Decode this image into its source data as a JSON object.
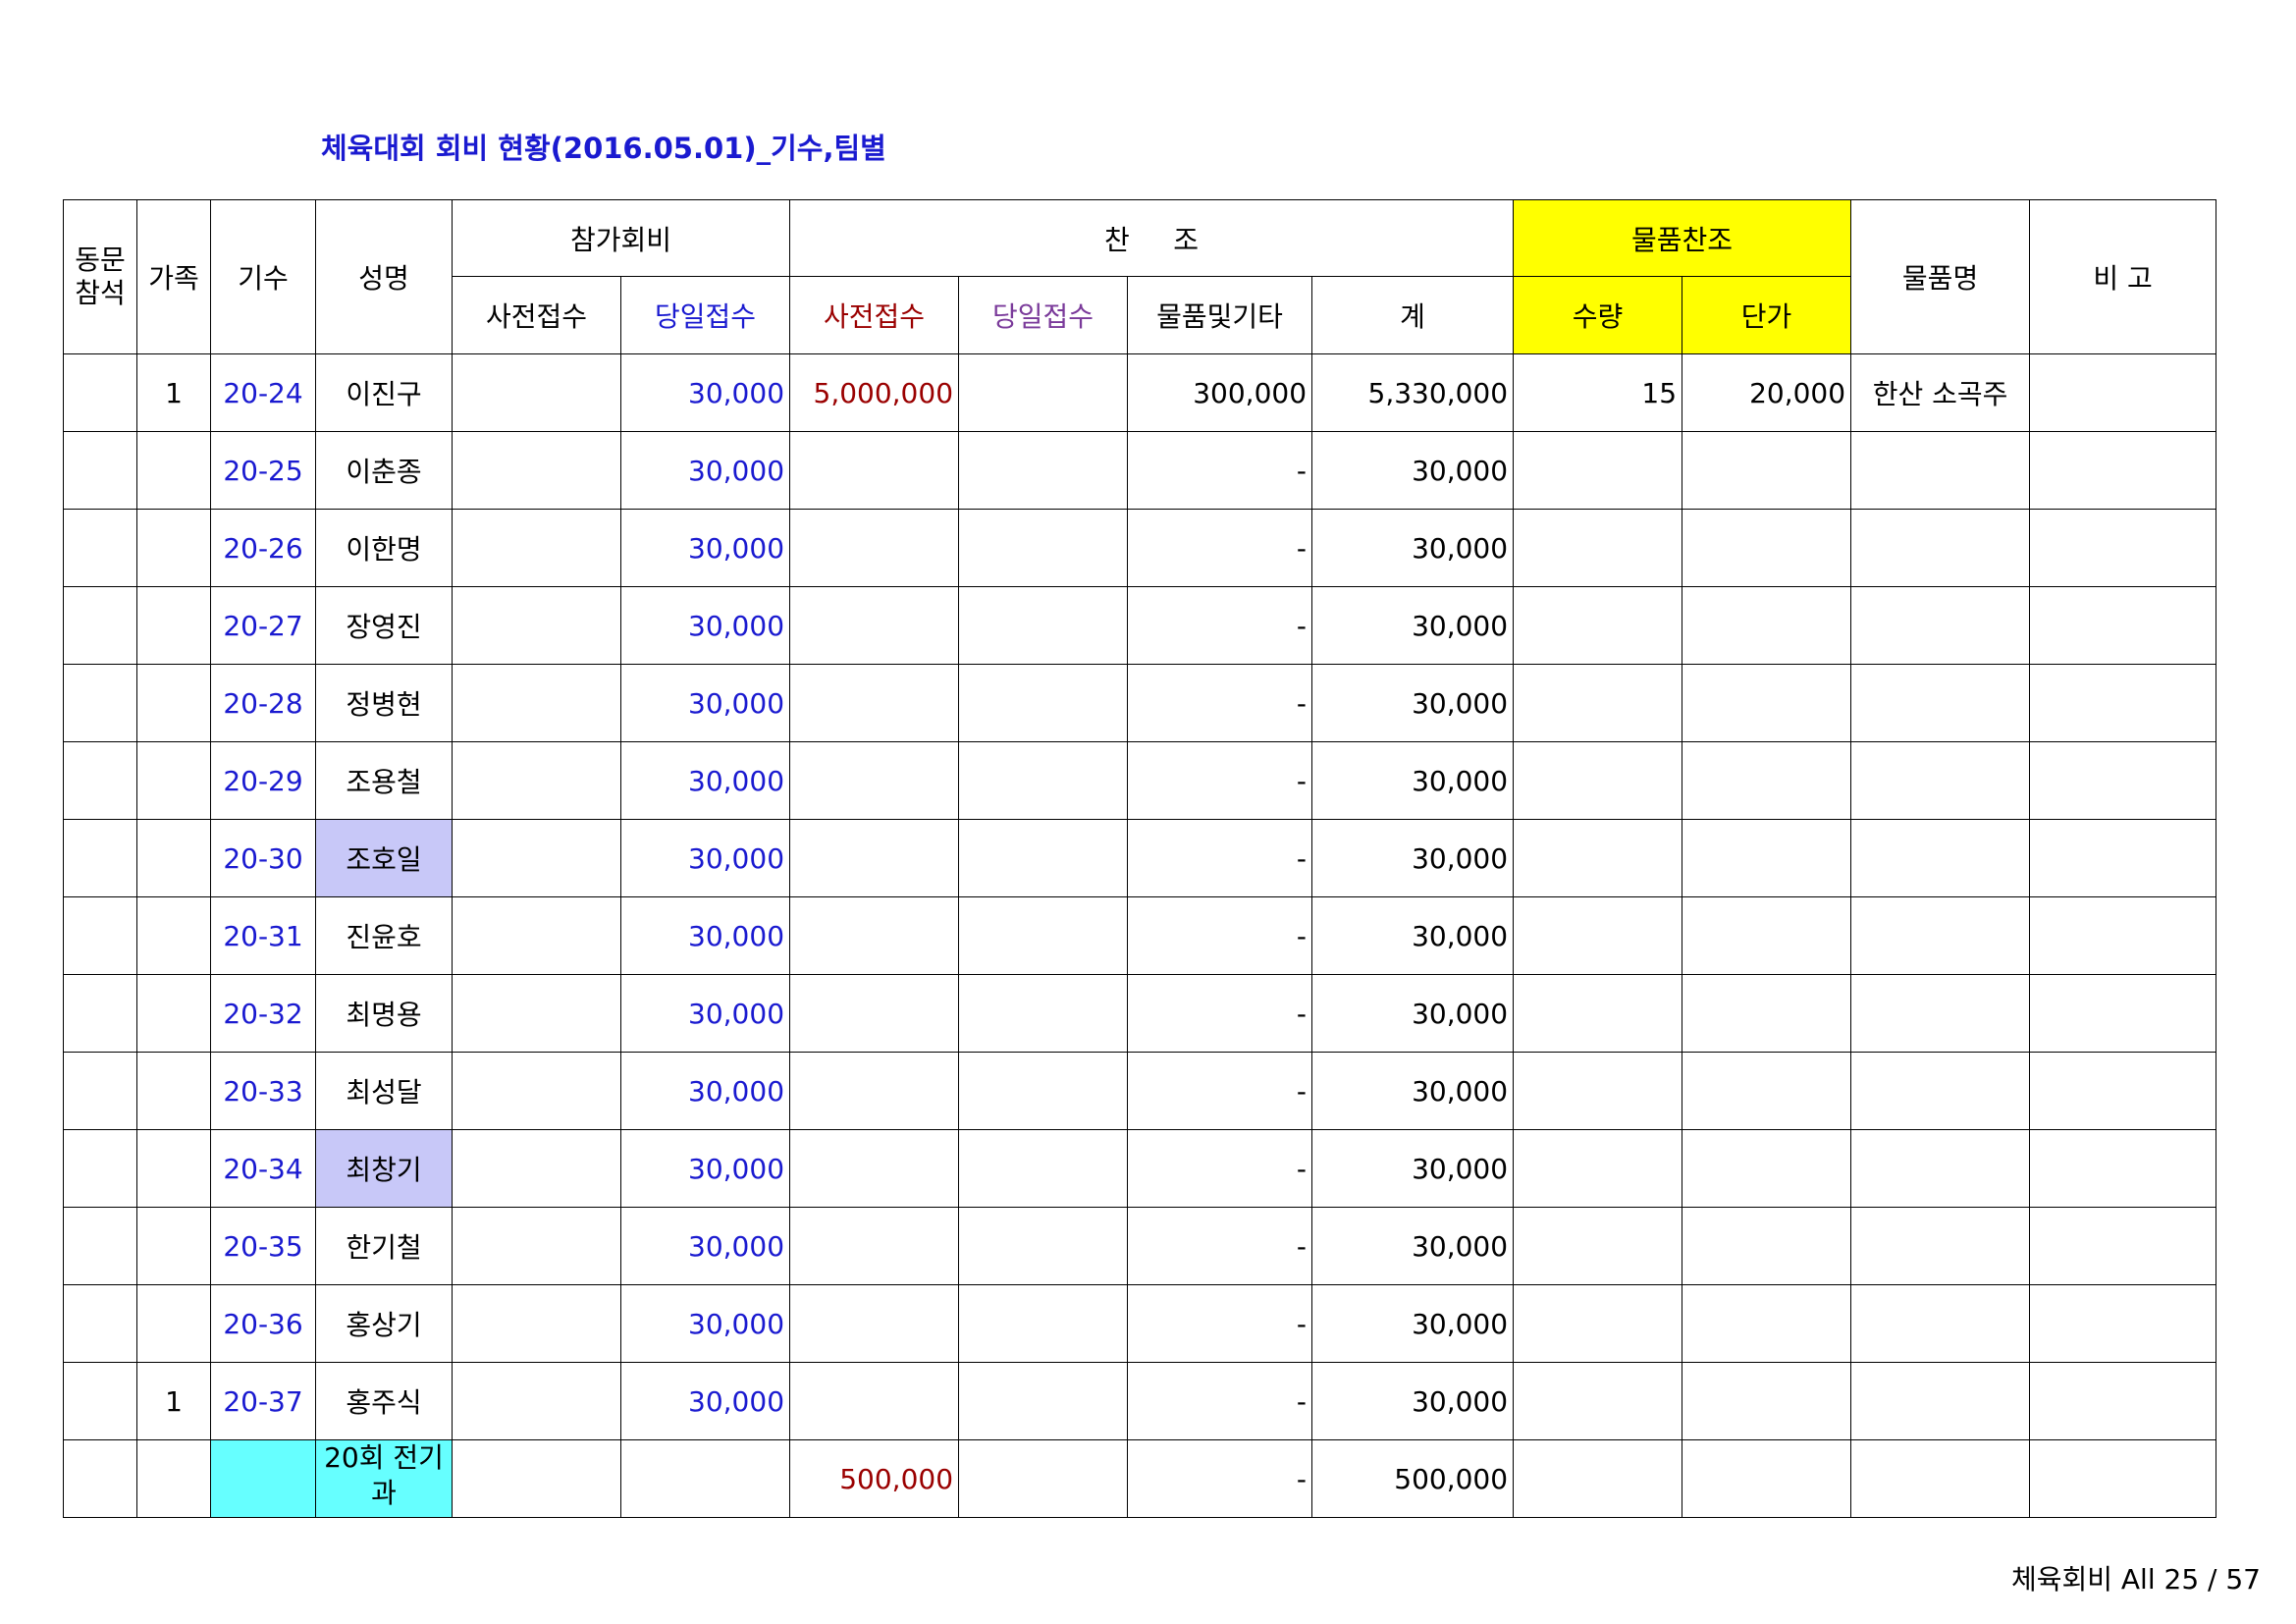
{
  "title": "체육대회 회비 현황(2016.05.01)_기수,팀별",
  "headers": {
    "attend": "동문 참석",
    "family": "가족",
    "gisu": "기수",
    "name": "성명",
    "fee_group": "참가회비",
    "sponsor_group": "찬     조",
    "goods_group": "물품찬조",
    "goods_name": "물품명",
    "note": "비 고",
    "fee_pre": "사전접수",
    "fee_day": "당일접수",
    "sp_pre": "사전접수",
    "sp_day": "당일접수",
    "sp_goods": "물품및기타",
    "sp_total": "계",
    "qty": "수량",
    "price": "단가"
  },
  "rows": [
    {
      "attend": "",
      "family": "1",
      "gisu": "20-24",
      "name": "이진구",
      "fee_pre": "",
      "fee_day": "30,000",
      "sp_pre": "5,000,000",
      "sp_day": "",
      "sp_goods": "300,000",
      "sp_total": "5,330,000",
      "qty": "15",
      "price": "20,000",
      "goods_name": "한산 소곡주",
      "note": "",
      "highlight": ""
    },
    {
      "attend": "",
      "family": "",
      "gisu": "20-25",
      "name": "이춘종",
      "fee_pre": "",
      "fee_day": "30,000",
      "sp_pre": "",
      "sp_day": "",
      "sp_goods": "-",
      "sp_total": "30,000",
      "qty": "",
      "price": "",
      "goods_name": "",
      "note": "",
      "highlight": ""
    },
    {
      "attend": "",
      "family": "",
      "gisu": "20-26",
      "name": "이한명",
      "fee_pre": "",
      "fee_day": "30,000",
      "sp_pre": "",
      "sp_day": "",
      "sp_goods": "-",
      "sp_total": "30,000",
      "qty": "",
      "price": "",
      "goods_name": "",
      "note": "",
      "highlight": ""
    },
    {
      "attend": "",
      "family": "",
      "gisu": "20-27",
      "name": "장영진",
      "fee_pre": "",
      "fee_day": "30,000",
      "sp_pre": "",
      "sp_day": "",
      "sp_goods": "-",
      "sp_total": "30,000",
      "qty": "",
      "price": "",
      "goods_name": "",
      "note": "",
      "highlight": ""
    },
    {
      "attend": "",
      "family": "",
      "gisu": "20-28",
      "name": "정병현",
      "fee_pre": "",
      "fee_day": "30,000",
      "sp_pre": "",
      "sp_day": "",
      "sp_goods": "-",
      "sp_total": "30,000",
      "qty": "",
      "price": "",
      "goods_name": "",
      "note": "",
      "highlight": ""
    },
    {
      "attend": "",
      "family": "",
      "gisu": "20-29",
      "name": "조용철",
      "fee_pre": "",
      "fee_day": "30,000",
      "sp_pre": "",
      "sp_day": "",
      "sp_goods": "-",
      "sp_total": "30,000",
      "qty": "",
      "price": "",
      "goods_name": "",
      "note": "",
      "highlight": ""
    },
    {
      "attend": "",
      "family": "",
      "gisu": "20-30",
      "name": "조호일",
      "fee_pre": "",
      "fee_day": "30,000",
      "sp_pre": "",
      "sp_day": "",
      "sp_goods": "-",
      "sp_total": "30,000",
      "qty": "",
      "price": "",
      "goods_name": "",
      "note": "",
      "highlight": "#c8c8f8"
    },
    {
      "attend": "",
      "family": "",
      "gisu": "20-31",
      "name": "진윤호",
      "fee_pre": "",
      "fee_day": "30,000",
      "sp_pre": "",
      "sp_day": "",
      "sp_goods": "-",
      "sp_total": "30,000",
      "qty": "",
      "price": "",
      "goods_name": "",
      "note": "",
      "highlight": ""
    },
    {
      "attend": "",
      "family": "",
      "gisu": "20-32",
      "name": "최명용",
      "fee_pre": "",
      "fee_day": "30,000",
      "sp_pre": "",
      "sp_day": "",
      "sp_goods": "-",
      "sp_total": "30,000",
      "qty": "",
      "price": "",
      "goods_name": "",
      "note": "",
      "highlight": ""
    },
    {
      "attend": "",
      "family": "",
      "gisu": "20-33",
      "name": "최성달",
      "fee_pre": "",
      "fee_day": "30,000",
      "sp_pre": "",
      "sp_day": "",
      "sp_goods": "-",
      "sp_total": "30,000",
      "qty": "",
      "price": "",
      "goods_name": "",
      "note": "",
      "highlight": ""
    },
    {
      "attend": "",
      "family": "",
      "gisu": "20-34",
      "name": "최창기",
      "fee_pre": "",
      "fee_day": "30,000",
      "sp_pre": "",
      "sp_day": "",
      "sp_goods": "-",
      "sp_total": "30,000",
      "qty": "",
      "price": "",
      "goods_name": "",
      "note": "",
      "highlight": "#c8c8f8"
    },
    {
      "attend": "",
      "family": "",
      "gisu": "20-35",
      "name": "한기철",
      "fee_pre": "",
      "fee_day": "30,000",
      "sp_pre": "",
      "sp_day": "",
      "sp_goods": "-",
      "sp_total": "30,000",
      "qty": "",
      "price": "",
      "goods_name": "",
      "note": "",
      "highlight": ""
    },
    {
      "attend": "",
      "family": "",
      "gisu": "20-36",
      "name": "홍상기",
      "fee_pre": "",
      "fee_day": "30,000",
      "sp_pre": "",
      "sp_day": "",
      "sp_goods": "-",
      "sp_total": "30,000",
      "qty": "",
      "price": "",
      "goods_name": "",
      "note": "",
      "highlight": ""
    },
    {
      "attend": "",
      "family": "1",
      "gisu": "20-37",
      "name": "홍주식",
      "fee_pre": "",
      "fee_day": "30,000",
      "sp_pre": "",
      "sp_day": "",
      "sp_goods": "-",
      "sp_total": "30,000",
      "qty": "",
      "price": "",
      "goods_name": "",
      "note": "",
      "highlight": ""
    }
  ],
  "summary": {
    "name": "20회 전기과",
    "sp_pre": "500,000",
    "sp_goods": "-",
    "sp_total": "500,000"
  },
  "colors": {
    "title": "#1a1ad0",
    "blue_text": "#1a1ad0",
    "maroon_text": "#9a0000",
    "purple_text": "#7a3a9a",
    "yellow_header": "#ffff00",
    "lavender_cell": "#c8c8f8",
    "cyan_cell": "#66ffff"
  },
  "footer": "체육회비 All 25 / 57"
}
